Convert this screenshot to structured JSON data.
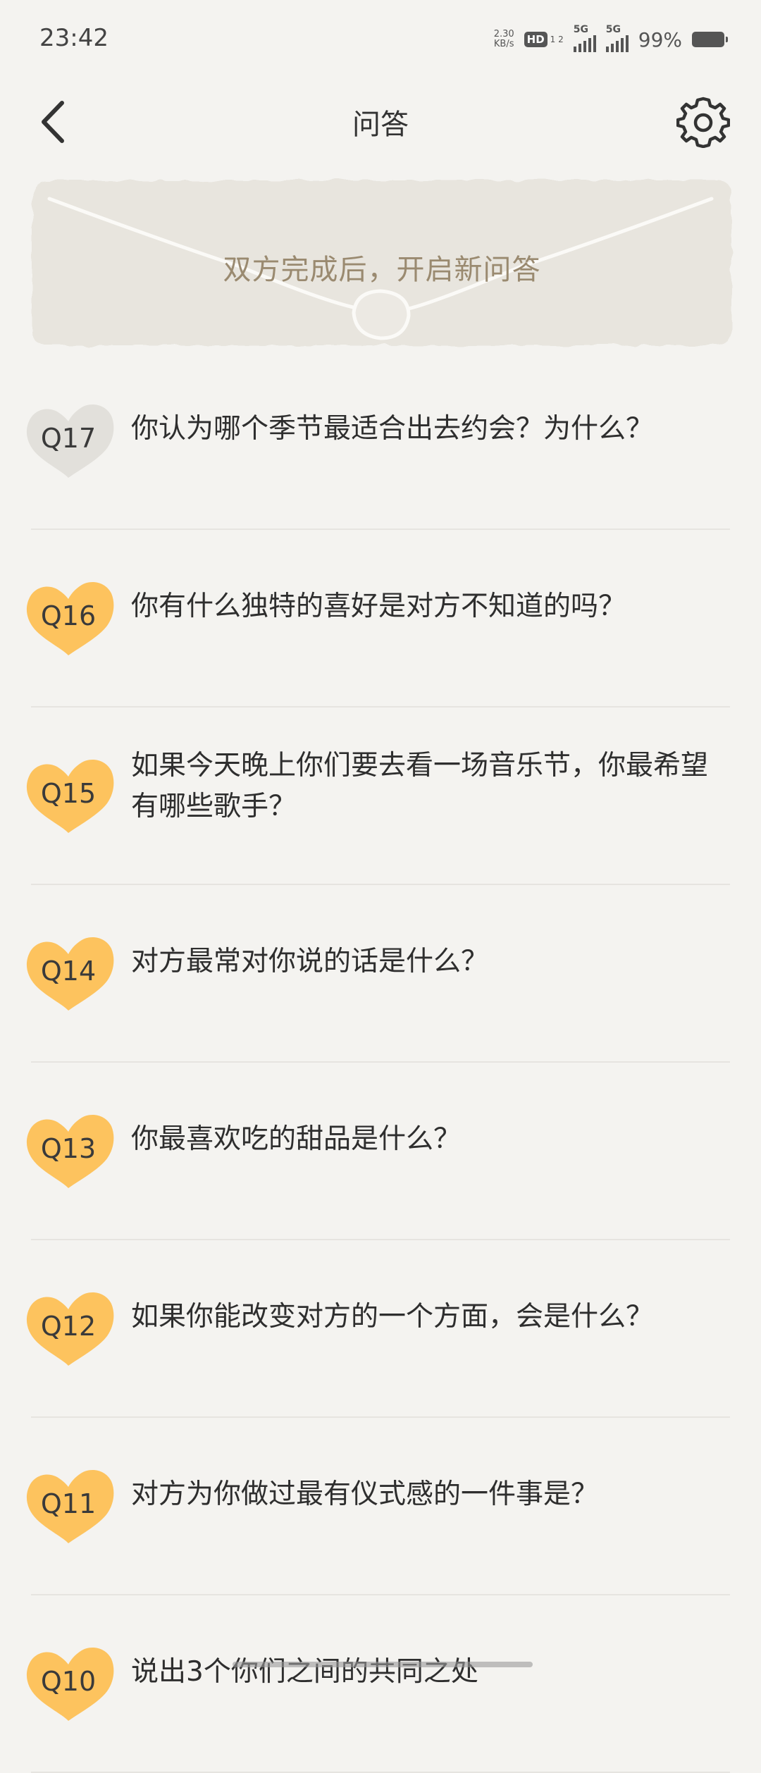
{
  "status_bar": {
    "time": "23:42",
    "net_speed_value": "2.30",
    "net_speed_unit": "KB/s",
    "hd_label": "HD",
    "hd_sub": "1 2",
    "signal1": "5G",
    "signal2": "5G",
    "battery": "99%"
  },
  "header": {
    "title": "问答",
    "back_icon": "chevron-left-icon",
    "settings_icon": "gear-icon"
  },
  "banner": {
    "text": "双方完成后，开启新问答"
  },
  "colors": {
    "badge_done": "#fdc35e",
    "badge_pending": "#e2e0db",
    "background": "#f4f3f0"
  },
  "questions": [
    {
      "num": "Q17",
      "text": "你认为哪个季节最适合出去约会？为什么？",
      "state": "pending"
    },
    {
      "num": "Q16",
      "text": "你有什么独特的喜好是对方不知道的吗？",
      "state": "done"
    },
    {
      "num": "Q15",
      "text": "如果今天晚上你们要去看一场音乐节，你最希望有哪些歌手？",
      "state": "done"
    },
    {
      "num": "Q14",
      "text": "对方最常对你说的话是什么？",
      "state": "done"
    },
    {
      "num": "Q13",
      "text": "你最喜欢吃的甜品是什么？",
      "state": "done"
    },
    {
      "num": "Q12",
      "text": "如果你能改变对方的一个方面，会是什么？",
      "state": "done"
    },
    {
      "num": "Q11",
      "text": "对方为你做过最有仪式感的一件事是？",
      "state": "done"
    },
    {
      "num": "Q10",
      "text": "说出3个你们之间的共同之处",
      "state": "done"
    }
  ]
}
